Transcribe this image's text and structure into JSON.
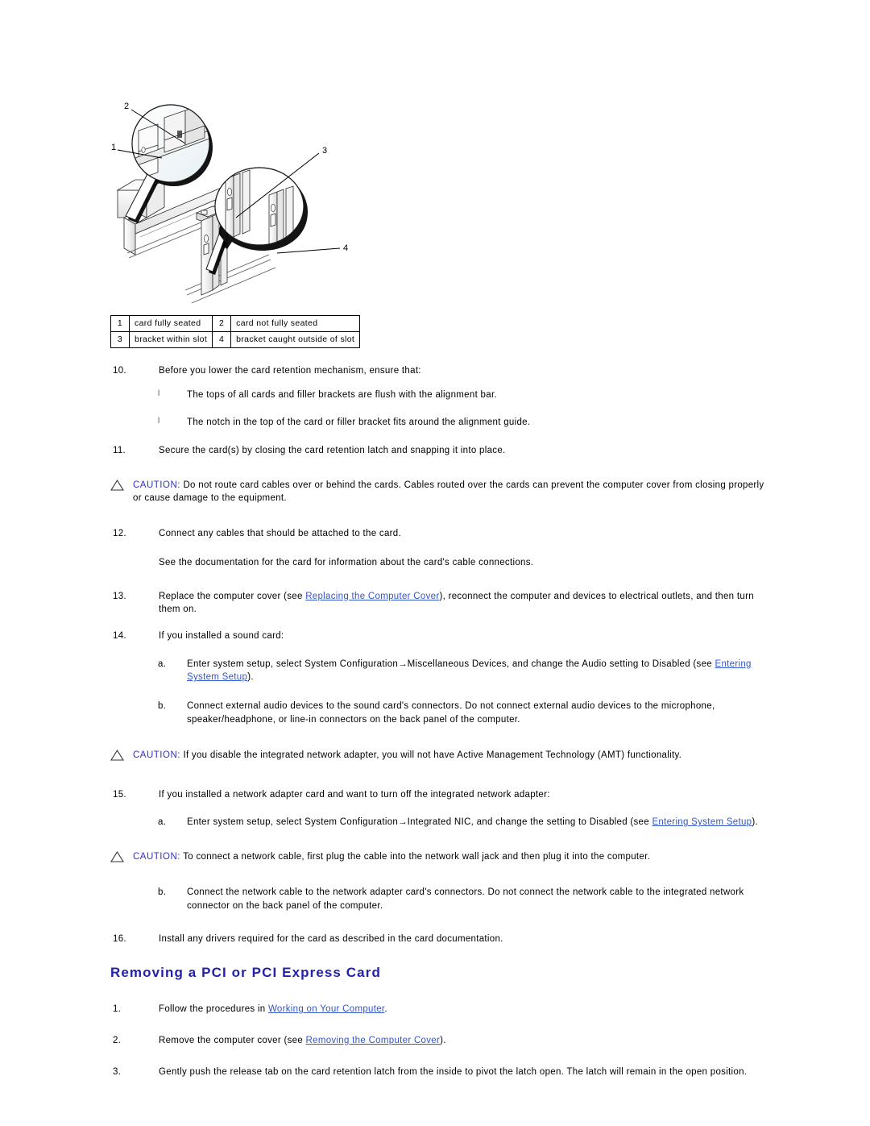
{
  "figure": {
    "alt": "Exploded view of card brackets and alignment bar with two magnified callouts",
    "callout_numbers": [
      "1",
      "2",
      "3",
      "4"
    ]
  },
  "legend": {
    "rows": [
      [
        {
          "num": "1",
          "label": "card fully seated"
        },
        {
          "num": "2",
          "label": "card not fully seated"
        }
      ],
      [
        {
          "num": "3",
          "label": "bracket within slot"
        },
        {
          "num": "4",
          "label": "bracket caught outside of slot"
        }
      ]
    ]
  },
  "steps": {
    "s10": {
      "marker": "10.",
      "text": "Before you lower the card retention mechanism, ensure that:",
      "bullets": [
        "The tops of all cards and filler brackets are flush with the alignment bar.",
        "The notch in the top of the card or filler bracket fits around the alignment guide."
      ]
    },
    "s11": {
      "marker": "11.",
      "text": "Secure the card(s) by closing the card retention latch and snapping it into place."
    },
    "s12": {
      "marker": "12.",
      "text": "Connect any cables that should be attached to the card.",
      "note": "See the documentation for the card for information about the card's cable connections."
    },
    "s13": {
      "marker": "13.",
      "text_before": "Replace the computer cover (see ",
      "link": "Replacing the Computer Cover",
      "text_after": "), reconnect the computer and devices to electrical outlets, and then turn them on."
    },
    "s14": {
      "marker": "14.",
      "text": "If you installed a sound card:",
      "a": {
        "marker": "a.",
        "text_before": "Enter system setup, select System Configuration",
        "arrow": "→",
        "text_mid": "Miscellaneous Devices, and change the Audio setting to Disabled (see ",
        "link": "Entering System Setup",
        "text_after": ")."
      },
      "b": {
        "marker": "b.",
        "text": "Connect external audio devices to the sound card's connectors. Do not connect external audio devices to the microphone, speaker/headphone, or line-in connectors on the back panel of the computer."
      }
    },
    "s15": {
      "marker": "15.",
      "text": "If you installed a network adapter card and want to turn off the integrated network adapter:",
      "a": {
        "marker": "a.",
        "text_before": "Enter system setup, select System Configuration",
        "arrow": "→",
        "text_mid": "Integrated NIC, and change the setting to Disabled (see ",
        "link": "Entering System Setup",
        "text_after": ")."
      },
      "b": {
        "marker": "b.",
        "text": "Connect the network cable to the network adapter card's connectors. Do not connect the network cable to the integrated network connector on the back panel of the computer."
      }
    },
    "s16": {
      "marker": "16.",
      "text": "Install any drivers required for the card as described in the card documentation."
    }
  },
  "cautions": {
    "c1": {
      "word": "CAUTION:",
      "text": " Do not route card cables over or behind the cards. Cables routed over the cards can prevent the computer cover from closing properly or cause damage to the equipment."
    },
    "c2": {
      "word": "CAUTION:",
      "text": " If you disable the integrated network adapter, you will not have Active Management Technology (AMT) functionality."
    },
    "c3": {
      "word": "CAUTION:",
      "text": " To connect a network cable, first plug the cable into the network wall jack and then plug it into the computer."
    }
  },
  "section": {
    "heading": "Removing a PCI or PCI Express Card",
    "steps": {
      "r1": {
        "marker": "1.",
        "text_before": "Follow the procedures in ",
        "link": "Working on Your Computer",
        "text_after": "."
      },
      "r2": {
        "marker": "2.",
        "text_before": "Remove the computer cover (see ",
        "link": "Removing the Computer Cover",
        "text_after": ")."
      },
      "r3": {
        "marker": "3.",
        "text": "Gently push the release tab on the card retention latch from the inside to pivot the latch open. The latch will remain in the open position."
      }
    }
  },
  "colors": {
    "link": "#3355cc",
    "heading": "#2222aa",
    "caution": "#3333bb"
  }
}
